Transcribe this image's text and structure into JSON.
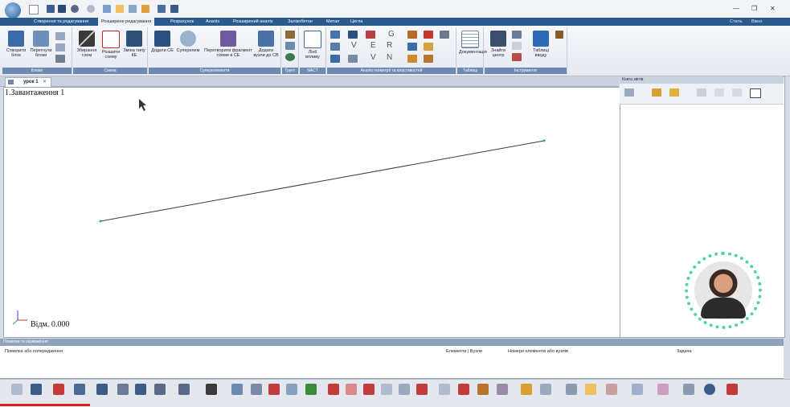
{
  "tabs": [
    "Створення та редагування",
    "Розширене редагування",
    "Розрахунок",
    "Аналіз",
    "Розширений аналіз",
    "Залізобетон",
    "Метал",
    "Цегла"
  ],
  "active_tab": "Розширене редагування",
  "window_controls": {
    "style_label": "Стиль",
    "window_label": "Вікно",
    "minimize": "—",
    "restore": "❐",
    "close": "✕"
  },
  "ribbon_groups": [
    {
      "label": "Блоки",
      "buttons": [
        "Створити блок",
        "Перетнути блоки"
      ]
    },
    {
      "label": "Схема",
      "buttons": [
        "Збирання схем",
        "Розшити схему",
        "Зміна типу КЕ"
      ]
    },
    {
      "label": "Суперелементи",
      "buttons": [
        "Додати СЕ",
        "Суперелем",
        "Перетворити фрагмент схеми в СЕ",
        "Додати вузли до СВ"
      ]
    },
    {
      "label": "Ґрунт",
      "buttons": []
    },
    {
      "label": "NACT",
      "buttons": [
        "Лінії впливу"
      ]
    },
    {
      "label": "Аналіз геометрії та властивостей",
      "buttons": []
    },
    {
      "label": "Таблиці",
      "buttons": [
        "Документація"
      ]
    },
    {
      "label": "Інструменти",
      "buttons": [
        "Знайти центр",
        "Таблиці вводу"
      ]
    }
  ],
  "ribbon_glyphs": [
    "G",
    "E",
    "R",
    "V",
    "N"
  ],
  "document_tab": {
    "label": "урок 1",
    "close": "✕"
  },
  "canvas": {
    "title": "1.Завантаження 1",
    "elevation": "Відм. 0.000"
  },
  "right_panel": {
    "title": "Книга звітів"
  },
  "messages": {
    "title": "Помилки та зауваження",
    "columns": [
      "Помилка або попередження",
      "Елементи | Вузли",
      "Номери елементів або вузлів",
      "Задача"
    ]
  },
  "icons": [
    "app-logo",
    "cursor-arrow-icon",
    "axis-triad-icon"
  ],
  "colors": {
    "accent": "#2c5a8c",
    "avatar_ring": "#4fd2b0"
  }
}
